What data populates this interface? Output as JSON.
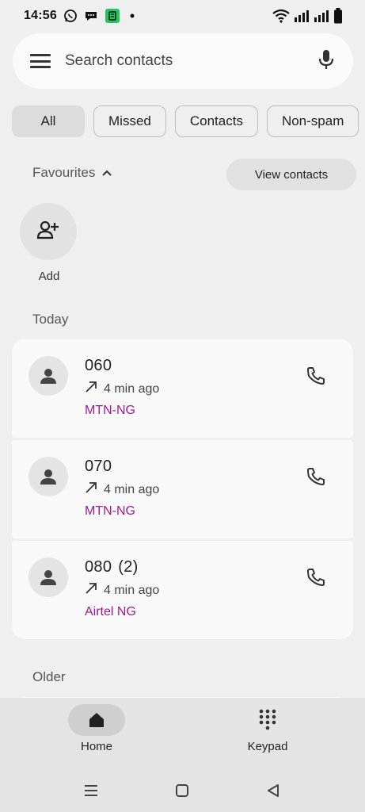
{
  "status_bar": {
    "time": "14:56",
    "icons": [
      "whatsapp-icon",
      "chat-bubble-icon",
      "green-app-icon",
      "dot-icon",
      "wifi-icon",
      "signal-icon",
      "signal-icon",
      "battery-icon"
    ]
  },
  "search": {
    "placeholder": "Search contacts",
    "menu_icon": "hamburger-menu-icon",
    "mic_icon": "microphone-icon"
  },
  "filters": {
    "chips": [
      {
        "label": "All",
        "active": true
      },
      {
        "label": "Missed",
        "active": false
      },
      {
        "label": "Contacts",
        "active": false
      },
      {
        "label": "Non-spam",
        "active": false
      }
    ]
  },
  "favourites": {
    "title": "Favourites",
    "view_contacts_label": "View contacts",
    "add_label": "Add"
  },
  "sections": {
    "today": "Today",
    "older": "Older"
  },
  "calls": [
    {
      "number": "060",
      "count": "",
      "time": "4 min ago",
      "carrier": "MTN-NG",
      "direction": "outgoing"
    },
    {
      "number": "070",
      "count": "",
      "time": "4 min ago",
      "carrier": "MTN-NG",
      "direction": "outgoing"
    },
    {
      "number": "080",
      "count": "(2)",
      "time": "4 min ago",
      "carrier": "Airtel NG",
      "direction": "outgoing"
    }
  ],
  "bottom_nav": {
    "items": [
      {
        "label": "Home",
        "icon": "home-icon",
        "active": true
      },
      {
        "label": "Keypad",
        "icon": "keypad-icon",
        "active": false
      }
    ]
  },
  "colors": {
    "background": "#efefef",
    "card": "#f9f9f9",
    "carrier_text": "#a11a8f",
    "nav_background": "#e4e4e4"
  }
}
